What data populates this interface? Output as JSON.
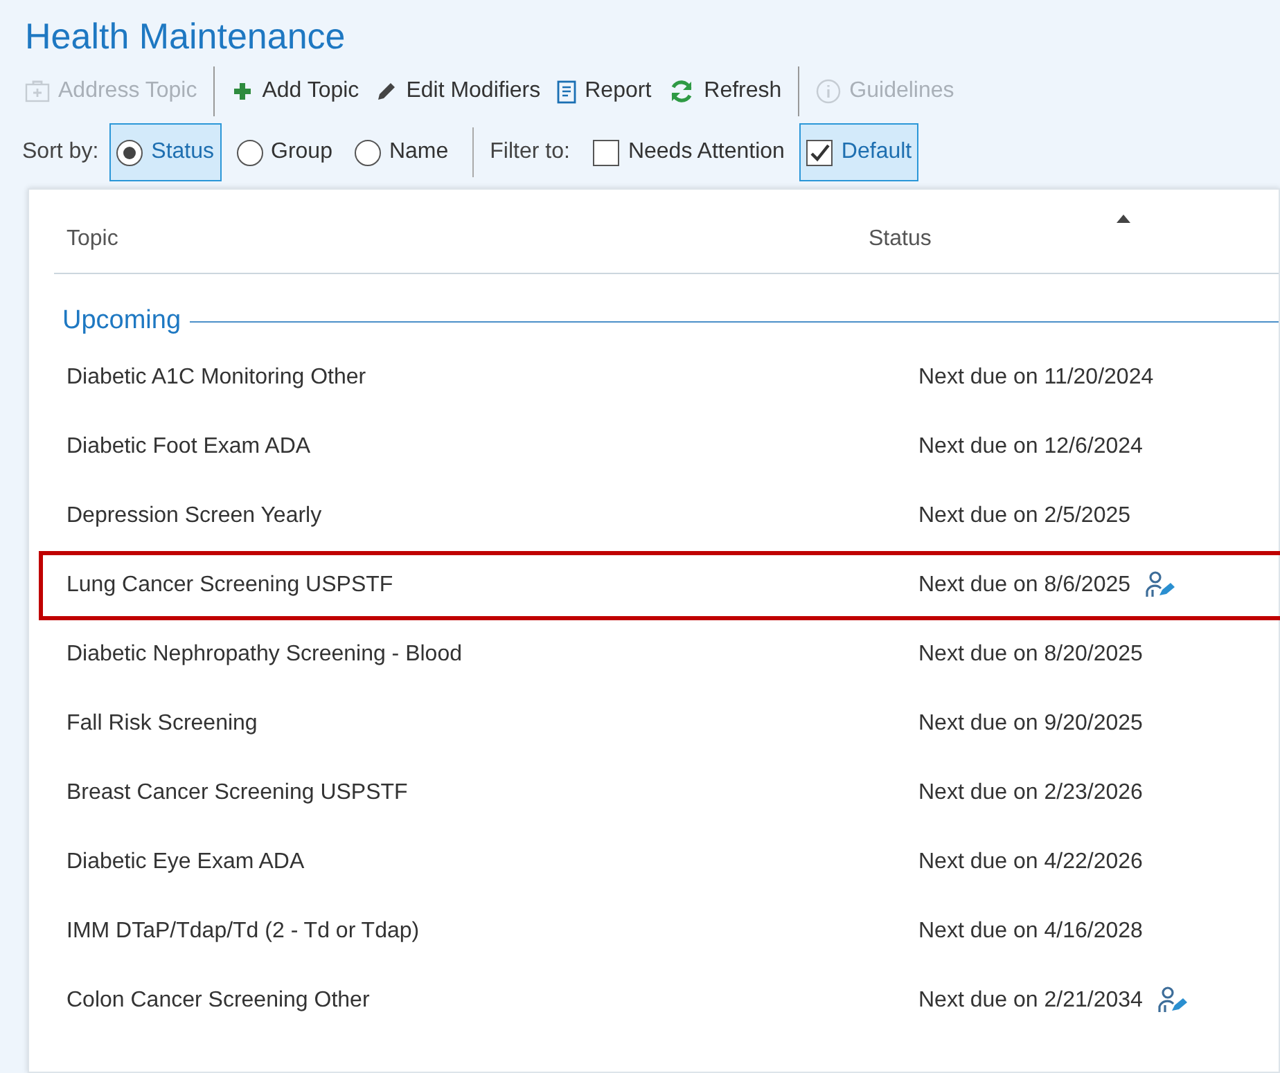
{
  "title": "Health Maintenance",
  "toolbar": [
    {
      "kind": "address",
      "label": "Address Topic",
      "disabled": true
    },
    {
      "kind": "separator"
    },
    {
      "kind": "add",
      "label": "Add Topic",
      "disabled": false
    },
    {
      "kind": "edit",
      "label": "Edit Modifiers",
      "disabled": false
    },
    {
      "kind": "report",
      "label": "Report",
      "disabled": false
    },
    {
      "kind": "refresh",
      "label": "Refresh",
      "disabled": false
    },
    {
      "kind": "separator"
    },
    {
      "kind": "guidelines",
      "label": "Guidelines",
      "disabled": true
    }
  ],
  "sort": {
    "label": "Sort by:",
    "options": [
      {
        "label": "Status",
        "selected": true
      },
      {
        "label": "Group",
        "selected": false
      },
      {
        "label": "Name",
        "selected": false
      }
    ]
  },
  "filter": {
    "label": "Filter to:",
    "options": [
      {
        "label": "Needs Attention",
        "checked": false
      },
      {
        "label": "Default",
        "checked": true
      }
    ]
  },
  "table": {
    "columns": [
      "Topic",
      "Status"
    ],
    "sort_ascending": true,
    "groups": [
      {
        "label": "Upcoming",
        "rows": [
          {
            "topic": "Diabetic A1C Monitoring Other",
            "status": "Next due on 11/20/2024",
            "modifier_icon": false,
            "highlighted": false
          },
          {
            "topic": "Diabetic Foot Exam ADA",
            "status": "Next due on 12/6/2024",
            "modifier_icon": false,
            "highlighted": false
          },
          {
            "topic": "Depression Screen Yearly",
            "status": "Next due on 2/5/2025",
            "modifier_icon": false,
            "highlighted": false
          },
          {
            "topic": "Lung Cancer Screening USPSTF",
            "status": "Next due on 8/6/2025",
            "modifier_icon": true,
            "highlighted": true
          },
          {
            "topic": "Diabetic Nephropathy Screening - Blood",
            "status": "Next due on 8/20/2025",
            "modifier_icon": false,
            "highlighted": false
          },
          {
            "topic": "Fall Risk Screening",
            "status": "Next due on 9/20/2025",
            "modifier_icon": false,
            "highlighted": false
          },
          {
            "topic": "Breast Cancer Screening USPSTF",
            "status": "Next due on 2/23/2026",
            "modifier_icon": false,
            "highlighted": false
          },
          {
            "topic": "Diabetic Eye Exam ADA",
            "status": "Next due on 4/22/2026",
            "modifier_icon": false,
            "highlighted": false
          },
          {
            "topic": "IMM DTaP/Tdap/Td (2 - Td or Tdap)",
            "status": "Next due on 4/16/2028",
            "modifier_icon": false,
            "highlighted": false
          },
          {
            "topic": "Colon Cancer Screening Other",
            "status": "Next due on 2/21/2034",
            "modifier_icon": true,
            "highlighted": false
          }
        ]
      }
    ]
  }
}
